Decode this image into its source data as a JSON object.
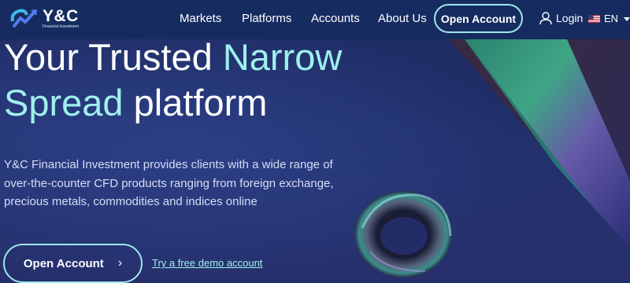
{
  "brand": {
    "name": "Y&C",
    "tagline": "Financial Investment",
    "colors": {
      "accent": "#9ff0ec",
      "nav_bg": "#162c60",
      "background": "#24306a"
    }
  },
  "nav": {
    "links": [
      "Markets",
      "Platforms",
      "Accounts",
      "About Us"
    ],
    "open_account": "Open Account",
    "login": "Login",
    "login_icon": "user-icon",
    "language": "EN",
    "language_icon": "us-flag-icon"
  },
  "hero": {
    "title_line1_white": "Your Trusted ",
    "title_line1_accent": "Narrow",
    "title_line2_accent": "Spread",
    "title_line2_white": " platform",
    "description": "Y&C Financial Investment provides clients with a wide range of over-the-counter CFD products ranging from foreign exchange, precious metals, commodities and indices online",
    "cta_label": "Open Account",
    "cta_icon": "chevron-right-icon",
    "demo_link": "Try a free demo account"
  }
}
